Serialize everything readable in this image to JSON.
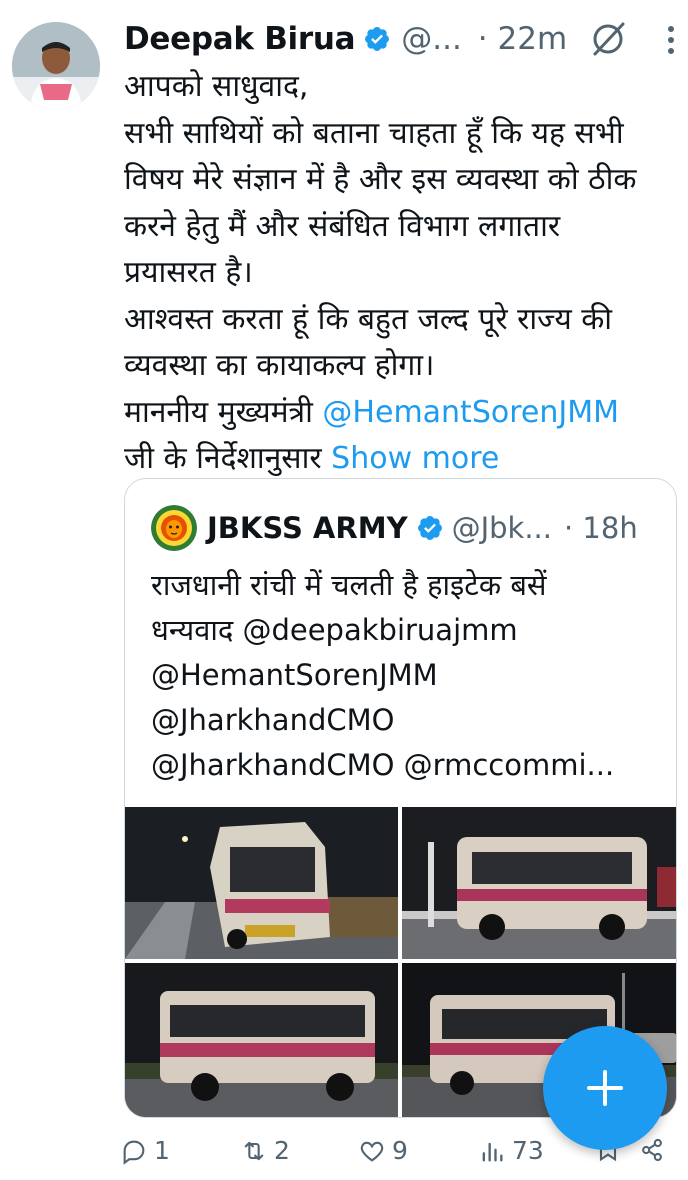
{
  "author": {
    "name": "Deepak Birua",
    "handle": "@...",
    "time": "· 22m",
    "avatar_icon": "profile-photo"
  },
  "tweet": {
    "lines": [
      "आपको साधुवाद,",
      "सभी साथियों को बताना चाहता हूँ कि यह सभी",
      "विषय मेरे संज्ञान में है और इस व्यवस्था को ठीक",
      "करने हेतु मैं और संबंधित विभाग लगातार",
      "प्रयासरत है।",
      "आश्वस्त करता हूं कि बहुत जल्द पूरे राज्य की",
      "व्यवस्था का कायाकल्प होगा।"
    ],
    "line8_prefix": "माननीय मुख्यमंत्री ",
    "line8_mention": "@HemantSorenJMM",
    "line9_prefix": "जी के निर्देशानुसार ",
    "show_more": "Show more"
  },
  "quoted": {
    "name": "JBKSS ARMY",
    "handle": "@Jbk...",
    "time": "· 18h",
    "line1": "राजधानी रांची में चलती है हाइटेक बसें",
    "line2_prefix": "धन्यवाद ",
    "line2_mention": "@deepakbiruajmm",
    "line3": "@HemantSorenJMM",
    "line4": "@JharkhandCMO",
    "line5a": "@JharkhandCMO",
    "line5b": " @rmccommi..."
  },
  "actions": {
    "replies": "1",
    "reposts": "2",
    "likes": "9",
    "views": "73"
  },
  "colors": {
    "accent": "#1d9bf0",
    "secondary_text": "#536471",
    "border": "#cfd9de"
  }
}
